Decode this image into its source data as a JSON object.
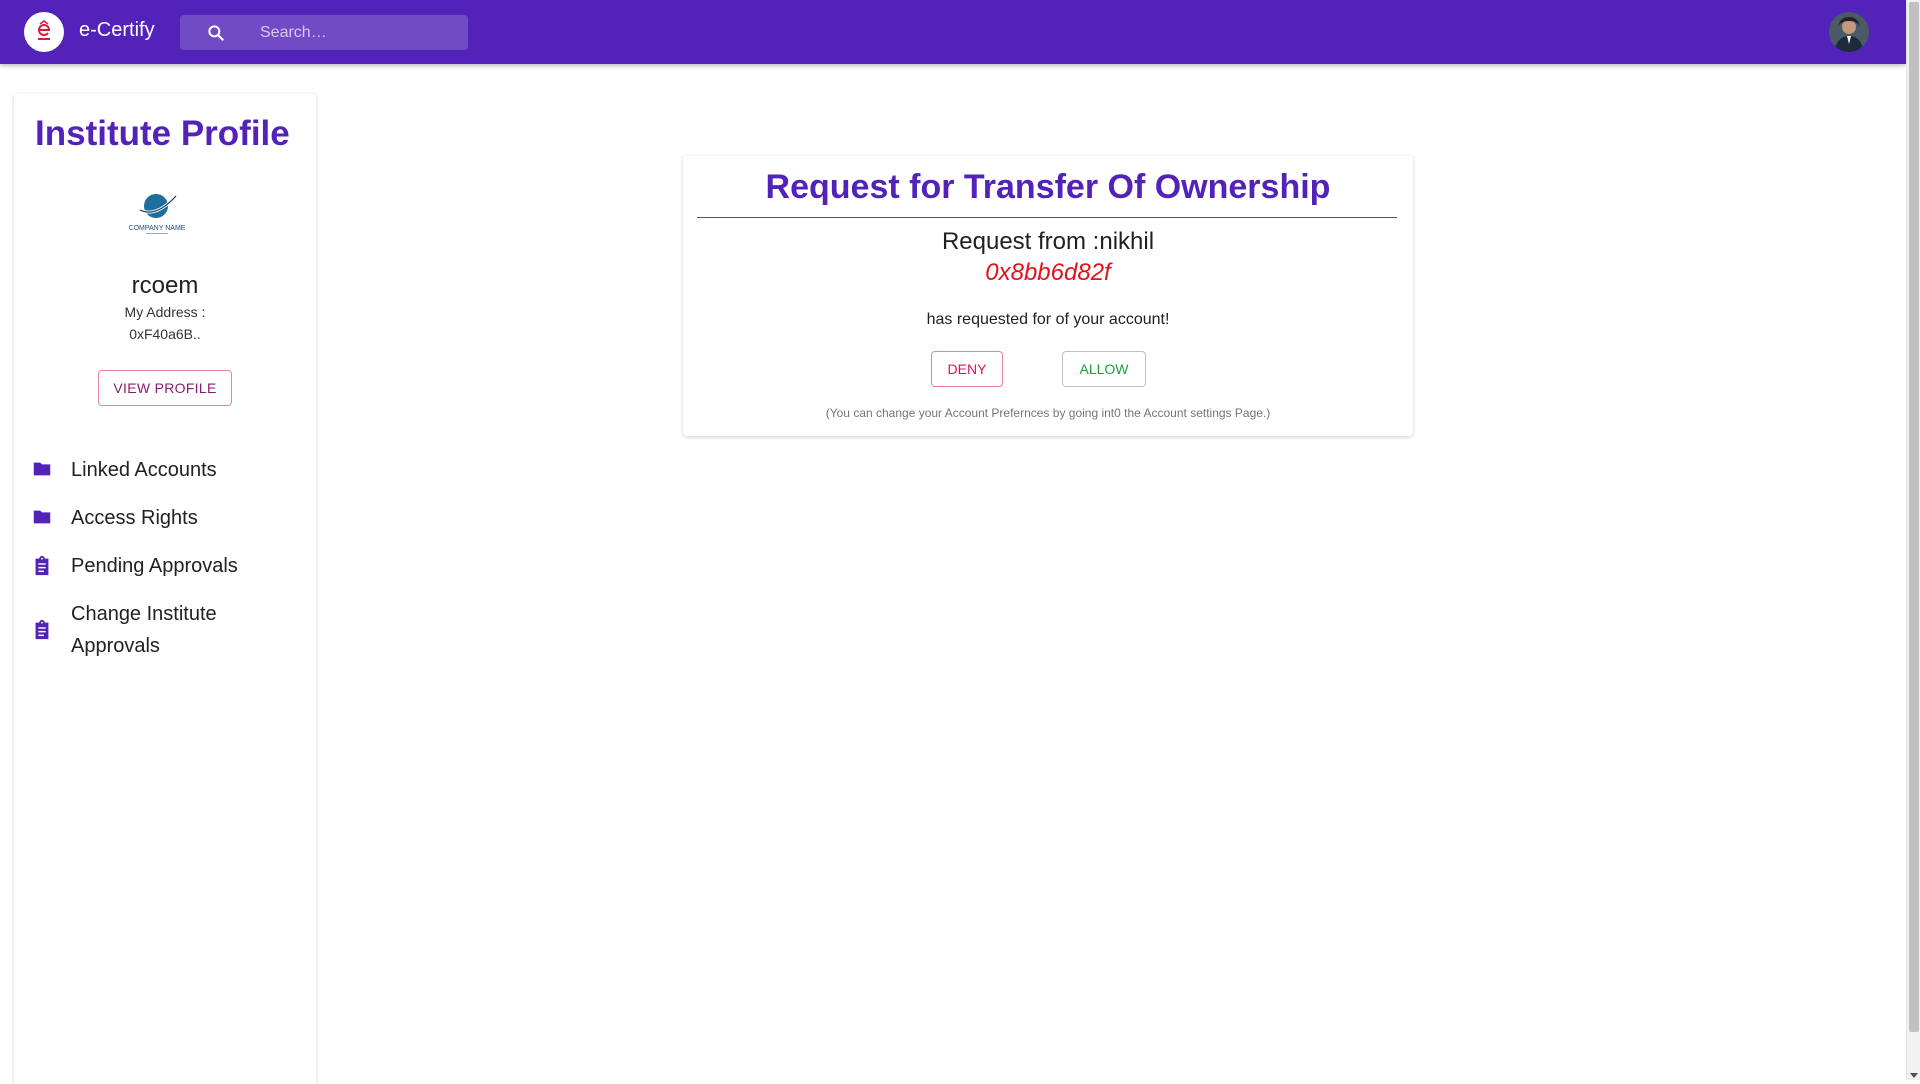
{
  "app": {
    "title": "e-Certify",
    "logo_icon": "e-certify-logo-icon",
    "brand_color": "#5323b9"
  },
  "search": {
    "placeholder": "Search…",
    "value": "",
    "icon": "search-icon"
  },
  "user": {
    "avatar_icon": "avatar"
  },
  "sidebar": {
    "title": "Institute Profile",
    "company_logo_text": "COMPANY NAME",
    "name": "rcoem",
    "address_label": "My Address :",
    "address": "0xF40a6B..",
    "view_profile_label": "VIEW PROFILE",
    "items": [
      {
        "label": "Linked Accounts",
        "icon": "folder-icon"
      },
      {
        "label": "Access Rights",
        "icon": "folder-icon"
      },
      {
        "label": "Pending Approvals",
        "icon": "clipboard-icon"
      },
      {
        "label": "Change Institute Approvals",
        "icon": "clipboard-icon"
      }
    ]
  },
  "request": {
    "title": "Request for Transfer Of Ownership",
    "from": "Request from :nikhil",
    "address": "0x8bb6d82f",
    "message": "has requested for of your account!",
    "deny_label": "DENY",
    "allow_label": "ALLOW",
    "note": "(You can change your Account Prefernces by going int0 the Account settings Page.)",
    "address_color": "#e0121c",
    "deny_color": "#e0115f",
    "allow_color": "#1a9e3c"
  }
}
